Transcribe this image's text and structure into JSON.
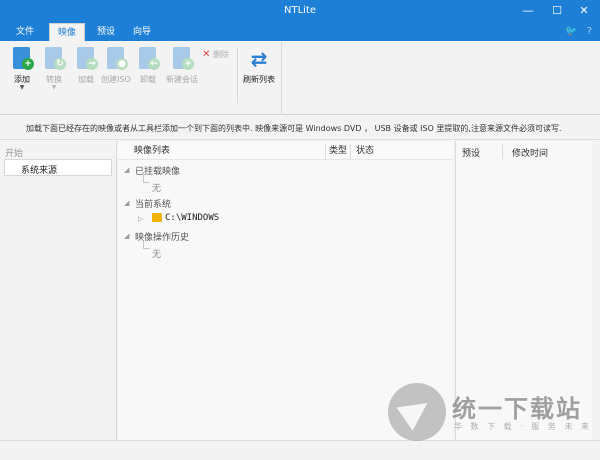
{
  "window": {
    "title": "NTLite",
    "minimize": "—",
    "maximize": "☐",
    "close": "✕"
  },
  "menu": {
    "tabs": [
      "文件",
      "映像",
      "预设",
      "向导"
    ],
    "active": "映像"
  },
  "ribbon": {
    "add": "添加",
    "convert": "转换",
    "load": "加载",
    "create_iso": "创建ISO",
    "unload": "卸载",
    "new_session": "新建会话",
    "delete": "删除",
    "refresh": "刷新列表"
  },
  "info": {
    "text": "加载下面已经存在的映像或者从工具栏添加一个到下面的列表中. 映像来源可是 Windows DVD ， USB 设备或 ISO 里提取的,注意来源文件必须可读写."
  },
  "left": {
    "start": "开始",
    "item": "系统来源"
  },
  "main": {
    "columns": [
      "映像列表",
      "类型",
      "状态"
    ],
    "tree": {
      "mounted": "已挂载映像",
      "mounted_child": "无",
      "current": "当前系统",
      "current_child": "C:\\WINDOWS",
      "history": "映像操作历史",
      "history_child": "无"
    }
  },
  "right": {
    "columns": [
      "预设",
      "修改时间"
    ]
  },
  "watermark": {
    "text": "统一下载站",
    "sub": "华 数 下 载 · 服 务 未 来"
  },
  "colors": {
    "accent": "#1e7fd6",
    "folder": "#f0b400",
    "add_badge": "#2aa84a",
    "delete_x": "#d94a4a"
  }
}
